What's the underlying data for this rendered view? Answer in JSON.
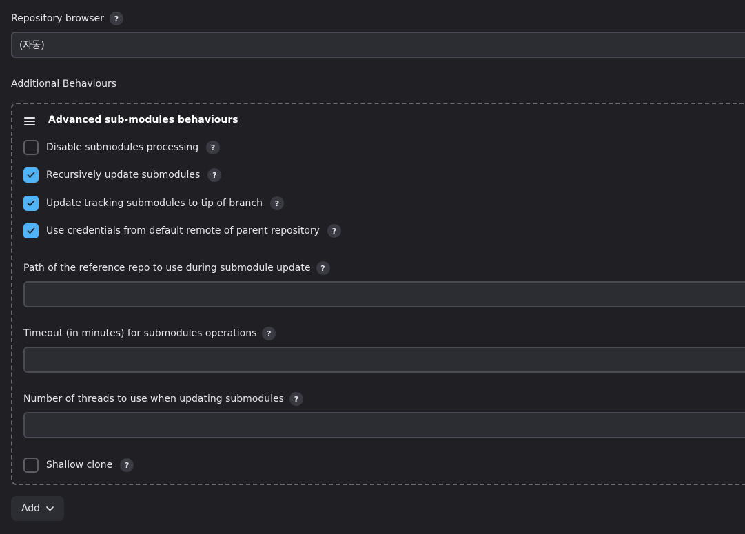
{
  "repository_browser": {
    "label": "Repository browser",
    "help": "?",
    "value": "(자동)"
  },
  "additional_behaviours": {
    "label": "Additional Behaviours",
    "section_title": "Advanced sub-modules behaviours",
    "checkboxes": [
      {
        "label": "Disable submodules processing",
        "checked": false,
        "help": "?"
      },
      {
        "label": "Recursively update submodules",
        "checked": true,
        "help": "?"
      },
      {
        "label": "Update tracking submodules to tip of branch",
        "checked": true,
        "help": "?"
      },
      {
        "label": "Use credentials from default remote of parent repository",
        "checked": true,
        "help": "?"
      }
    ],
    "fields": [
      {
        "label": "Path of the reference repo to use during submodule update",
        "value": "",
        "help": "?"
      },
      {
        "label": "Timeout (in minutes) for submodules operations",
        "value": "",
        "help": "?"
      },
      {
        "label": "Number of threads to use when updating submodules",
        "value": "",
        "help": "?"
      }
    ],
    "shallow_clone": {
      "label": "Shallow clone",
      "checked": false,
      "help": "?"
    }
  },
  "add_button": {
    "label": "Add",
    "icon": "chevron-down-icon"
  },
  "colors": {
    "background": "#1f1f24",
    "checkbox_checked": "#4fb3f6",
    "field_background": "#2c2c33"
  }
}
